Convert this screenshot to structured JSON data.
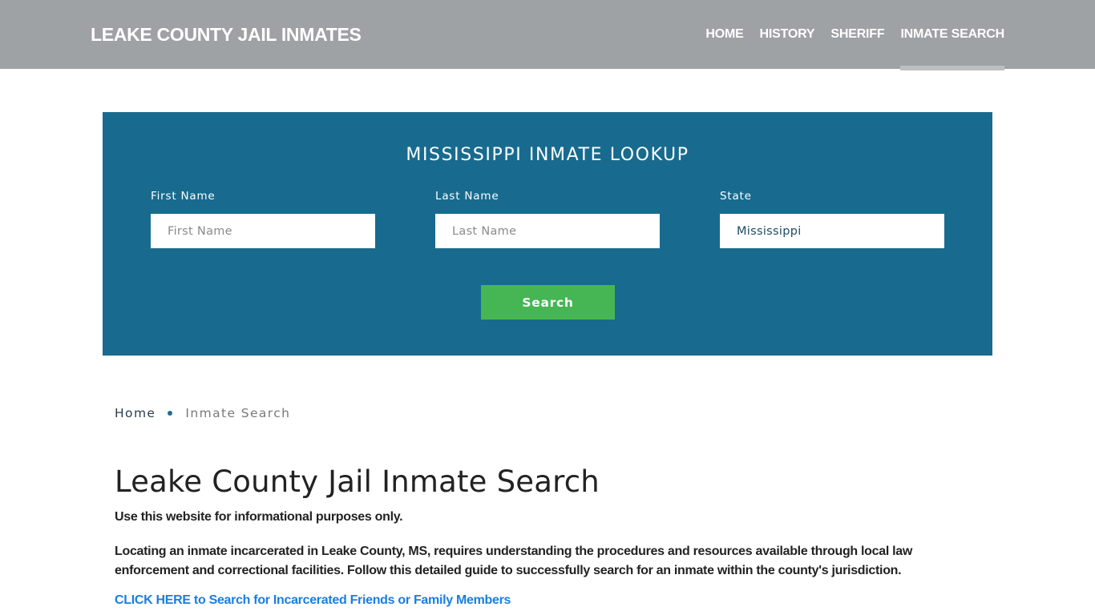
{
  "header": {
    "brand": "LEAKE COUNTY JAIL INMATES",
    "nav": [
      {
        "label": "HOME",
        "active": false
      },
      {
        "label": "HISTORY",
        "active": false
      },
      {
        "label": "SHERIFF",
        "active": false
      },
      {
        "label": "INMATE SEARCH",
        "active": true
      }
    ]
  },
  "lookup": {
    "title": "MISSISSIPPI INMATE LOOKUP",
    "first_name": {
      "label": "First Name",
      "placeholder": "First Name",
      "value": ""
    },
    "last_name": {
      "label": "Last Name",
      "placeholder": "Last Name",
      "value": ""
    },
    "state": {
      "label": "State",
      "value": "Mississippi"
    },
    "search_label": "Search"
  },
  "breadcrumb": {
    "home": "Home",
    "current": "Inmate Search"
  },
  "content": {
    "title": "Leake County Jail Inmate Search",
    "disclaimer": "Use this website for informational purposes only.",
    "intro": "Locating an inmate incarcerated in Leake County, MS, requires understanding the procedures and resources available through local law enforcement and correctional facilities. Follow this detailed guide to successfully search for an inmate within the county's jurisdiction.",
    "cta": "CLICK HERE to Search for Incarcerated Friends or Family Members"
  },
  "colors": {
    "header_bg": "#9ea2a5",
    "lookup_bg": "#186b8e",
    "search_button": "#45b653",
    "link": "#1a7ee0"
  }
}
